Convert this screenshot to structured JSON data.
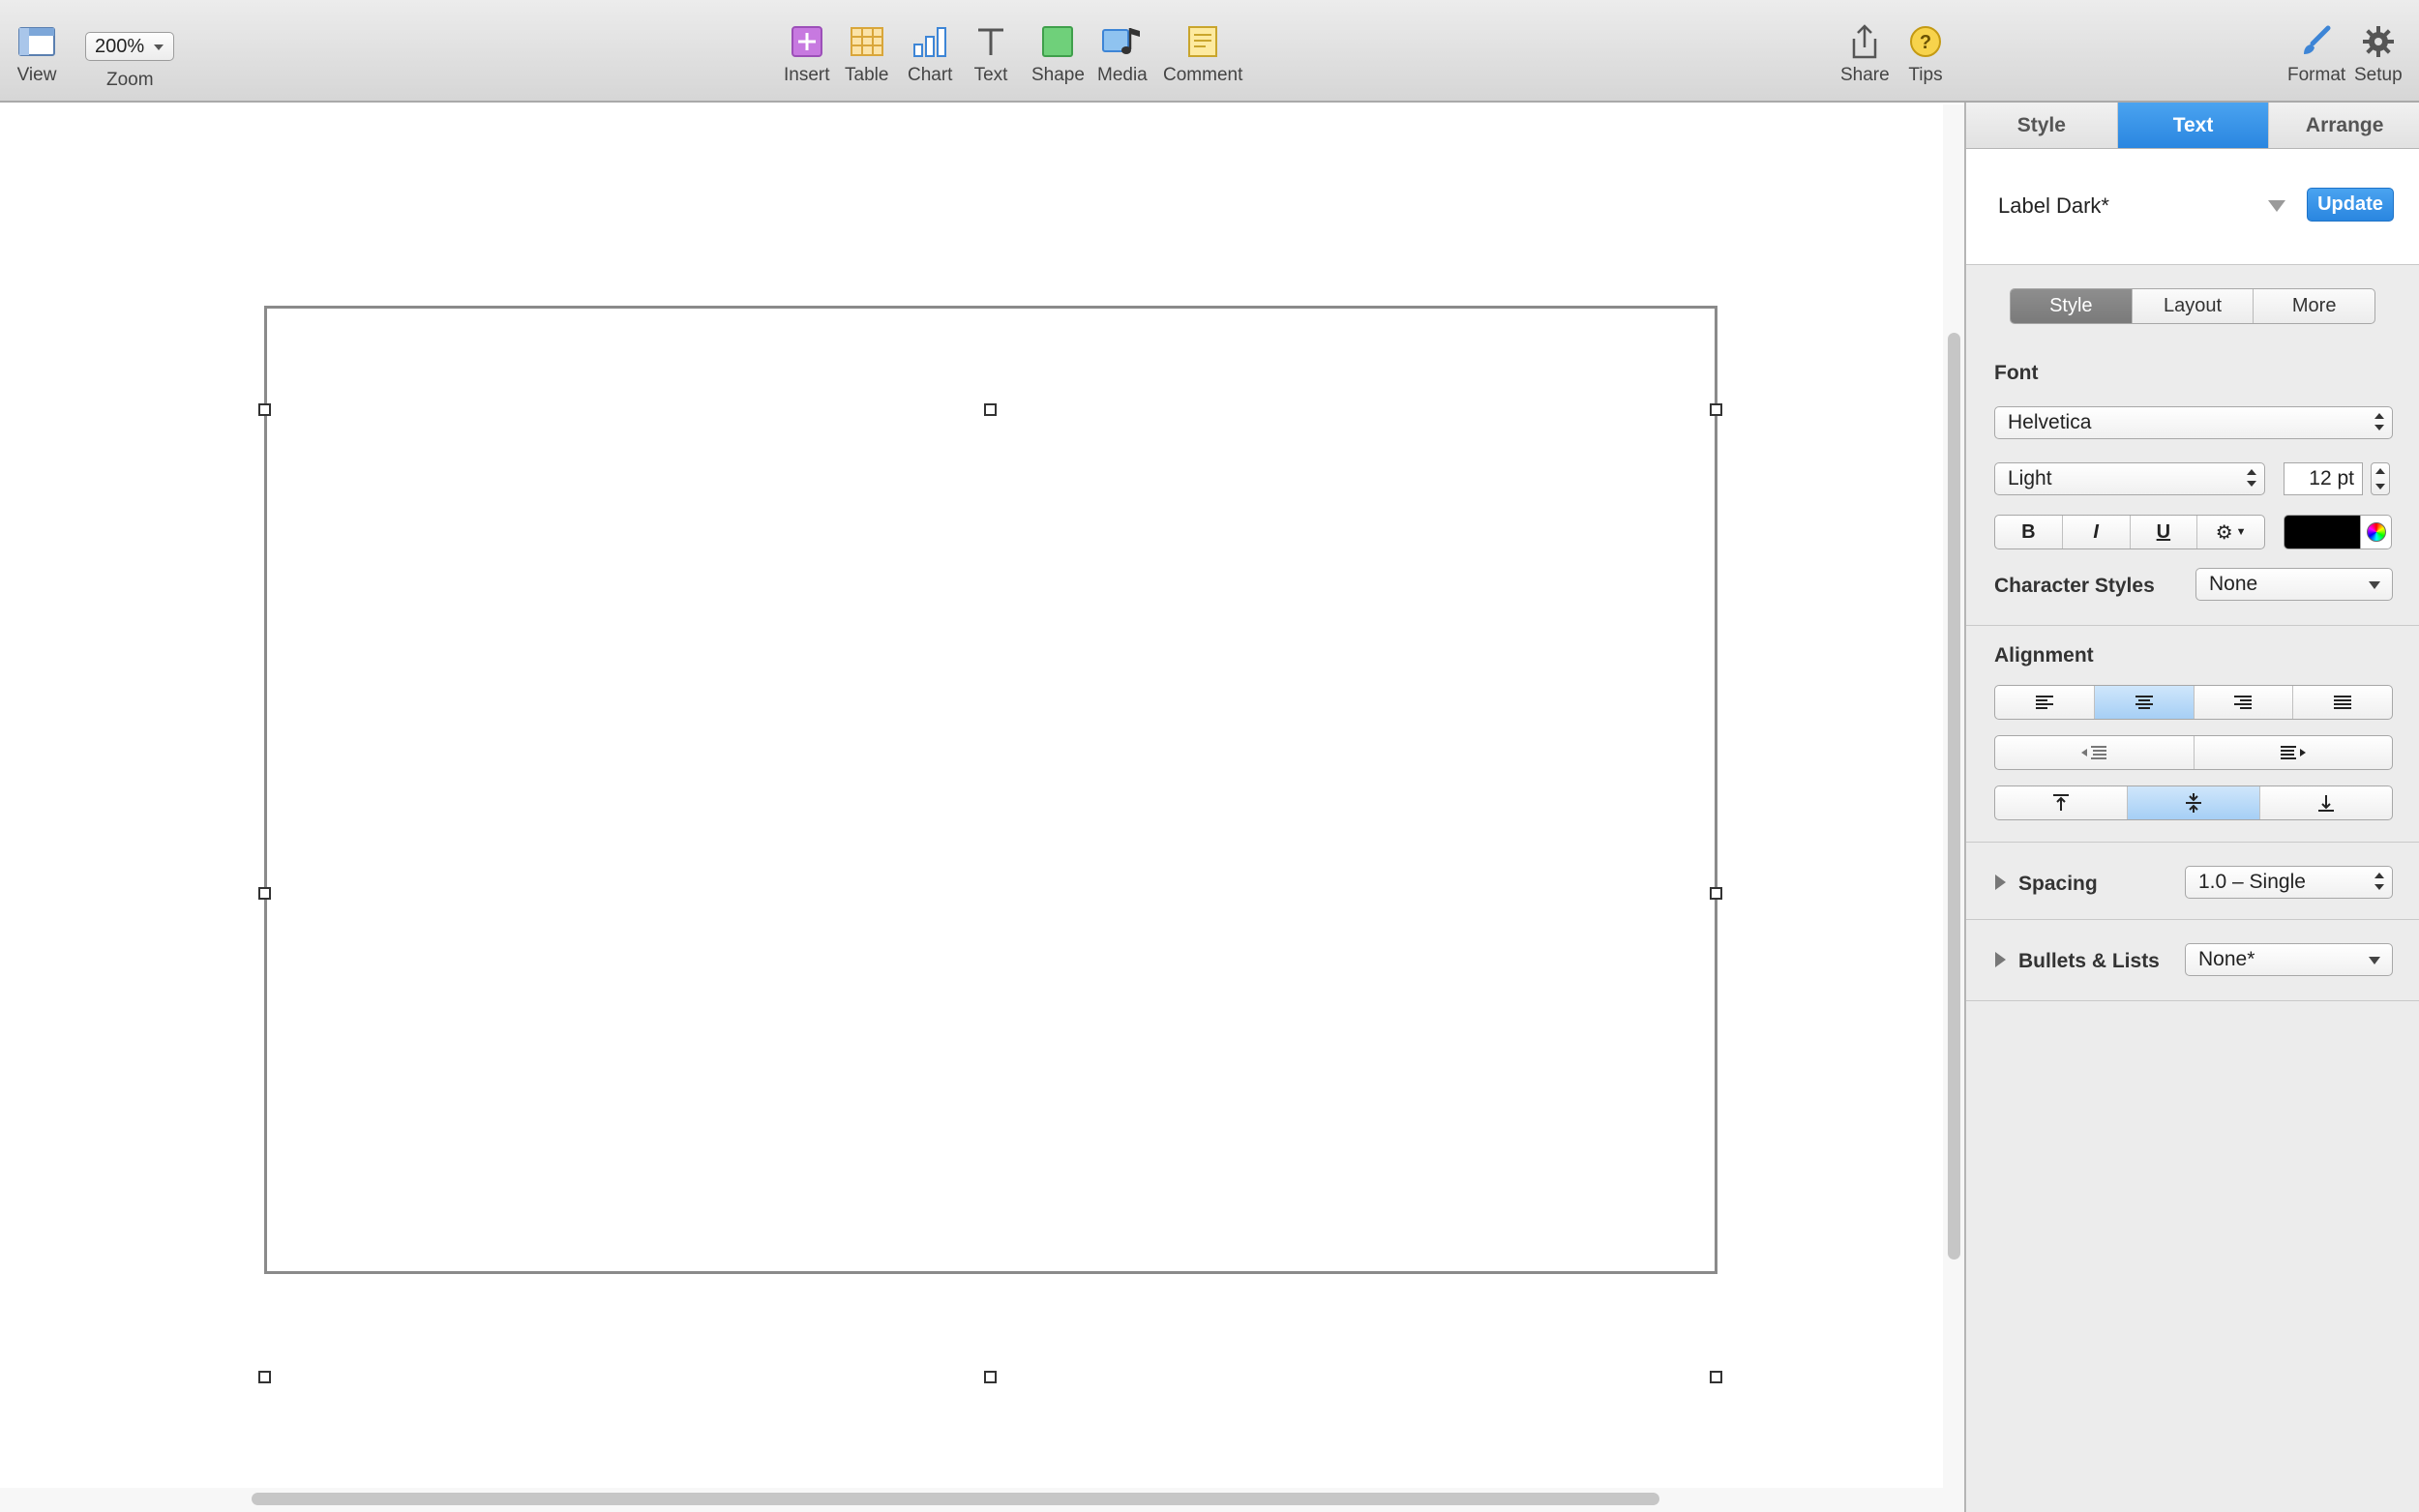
{
  "toolbar": {
    "view_label": "View",
    "zoom_value": "200%",
    "zoom_label": "Zoom",
    "insert_label": "Insert",
    "table_label": "Table",
    "chart_label": "Chart",
    "text_label": "Text",
    "shape_label": "Shape",
    "media_label": "Media",
    "comment_label": "Comment",
    "share_label": "Share",
    "tips_label": "Tips",
    "format_label": "Format",
    "setup_label": "Setup"
  },
  "inspector": {
    "tabs": [
      "Style",
      "Text",
      "Arrange"
    ],
    "active_tab": "Text",
    "paragraph_style": "Label Dark*",
    "update_label": "Update",
    "sub_tabs": [
      "Style",
      "Layout",
      "More"
    ],
    "active_sub_tab": "Style",
    "font_title": "Font",
    "font_family": "Helvetica",
    "font_typeface": "Light",
    "font_size": "12 pt",
    "bold_label": "B",
    "italic_label": "I",
    "underline_label": "U",
    "text_color": "#000000",
    "character_styles_label": "Character Styles",
    "character_styles_value": "None",
    "alignment_title": "Alignment",
    "horizontal_alignment_selected": "center",
    "vertical_alignment_selected": "middle",
    "spacing_label": "Spacing",
    "spacing_value": "1.0 – Single",
    "bullets_label": "Bullets & Lists",
    "bullets_value": "None*"
  },
  "colors": {
    "accent_blue": "#2a86e0",
    "selected_segment": "#a6cff5",
    "toolbar_bg": "#e0e0e0",
    "inspector_bg": "#ececec"
  }
}
